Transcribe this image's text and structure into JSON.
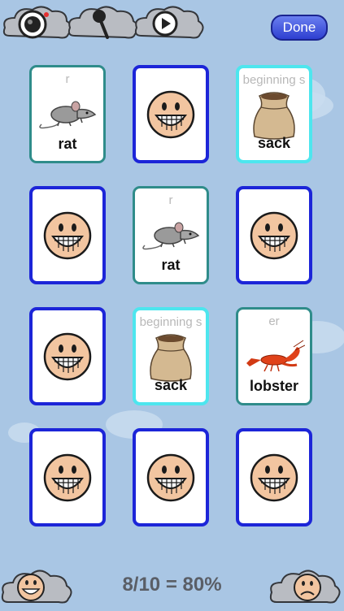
{
  "toolbar": {
    "icons": [
      "camera-icon",
      "microphone-icon",
      "play-icon"
    ],
    "done_label": "Done"
  },
  "cards": [
    {
      "state": "revealed",
      "sound": "r",
      "word": "rat",
      "image": "rat"
    },
    {
      "state": "hidden",
      "image": "smiley"
    },
    {
      "state": "revealed",
      "sound": "beginning s",
      "word": "sack",
      "image": "sack"
    },
    {
      "state": "hidden",
      "image": "smiley"
    },
    {
      "state": "revealed",
      "sound": "r",
      "word": "rat",
      "image": "rat"
    },
    {
      "state": "hidden",
      "image": "smiley"
    },
    {
      "state": "hidden",
      "image": "smiley"
    },
    {
      "state": "revealed",
      "sound": "beginning s",
      "word": "sack",
      "image": "sack"
    },
    {
      "state": "revealed",
      "sound": "er",
      "word": "lobster",
      "image": "lobster"
    },
    {
      "state": "hidden",
      "image": "smiley"
    },
    {
      "state": "hidden",
      "image": "smiley"
    },
    {
      "state": "hidden",
      "image": "smiley"
    }
  ],
  "footer": {
    "score_text": "8/10 = 80%",
    "left_icon": "happy-face-icon",
    "right_icon": "sad-face-icon"
  }
}
